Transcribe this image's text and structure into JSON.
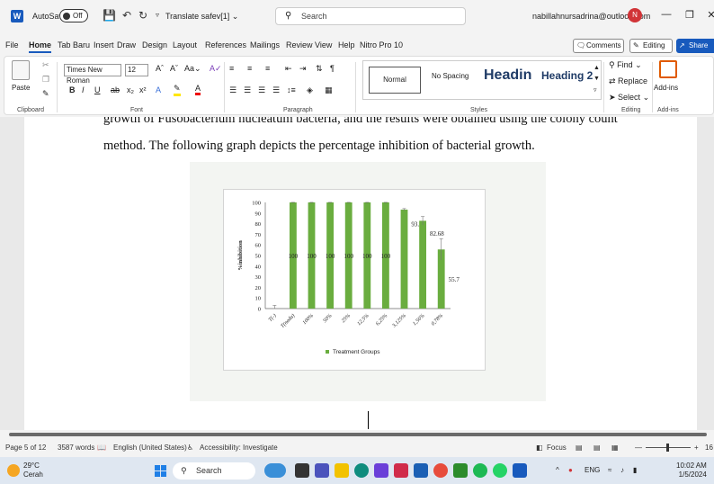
{
  "titlebar": {
    "app_logo": "W",
    "autosave_label": "AutoSave",
    "autosave_state": "Off",
    "doc_title": "Translate safev[1] ⌄",
    "search_placeholder": "Search",
    "account": "nabillahnursadrina@outlook.com",
    "avatar_initial": "N"
  },
  "tabs": [
    "File",
    "Home",
    "Tab Baru",
    "Insert",
    "Draw",
    "Design",
    "Layout",
    "References",
    "Mailings",
    "Review",
    "View",
    "Help",
    "Nitro Pro 10"
  ],
  "active_tab": "Home",
  "header_buttons": {
    "comments": "Comments",
    "editing": "Editing ⌄",
    "share": "Share"
  },
  "ribbon": {
    "paste_label": "Paste",
    "font_name": "Times New Roman",
    "font_size": "12",
    "bold": "B",
    "italic": "I",
    "underline": "U",
    "styles": {
      "normal": "Normal",
      "no_spacing": "No Spacing",
      "heading1": "Headin",
      "heading2": "Heading 2"
    },
    "find": "Find",
    "replace": "Replace",
    "select": "Select",
    "addins": "Add-ins",
    "groups": {
      "clipboard": "Clipboard",
      "font": "Font",
      "paragraph": "Paragraph",
      "styles": "Styles",
      "editing": "Editing",
      "addins": "Add-ins"
    }
  },
  "document": {
    "line1": "growth of Fusobacterium nucleatum bacteria, and the results were obtained using the colony count",
    "line2": "method. The following graph depicts the percentage inhibition of bacterial growth."
  },
  "chart_data": {
    "type": "bar",
    "categories": [
      "T(-)",
      "T(nada)",
      "100%",
      "50%",
      "25%",
      "12,5%",
      "6,25%",
      "3,125%",
      "1,56%",
      "0,78%"
    ],
    "values": [
      0,
      100,
      100,
      100,
      100,
      100,
      100,
      93.2,
      82.68,
      55.7
    ],
    "data_labels": [
      "",
      "100",
      "100",
      "100",
      "100",
      "100",
      "100",
      "93.2",
      "82.68",
      "55.7"
    ],
    "errors": [
      3,
      0,
      0,
      0,
      0,
      0,
      0,
      1,
      4,
      10
    ],
    "ylabel": "%inhibition",
    "ylim": [
      0,
      100
    ],
    "yticks": [
      0,
      10,
      20,
      30,
      40,
      50,
      60,
      70,
      80,
      90,
      100
    ],
    "legend": "Treatment Groups",
    "legend_position": "bottom",
    "bar_color": "#6aad3f",
    "grid": false
  },
  "status": {
    "page": "Page 5 of 12",
    "words": "3587 words",
    "language": "English (United States)",
    "accessibility": "Accessibility: Investigate",
    "focus": "Focus",
    "zoom": "16"
  },
  "taskbar": {
    "temp": "29°C",
    "condition": "Cerah",
    "search": "Search",
    "lang": "ENG",
    "time": "10:02 AM",
    "date": "1/5/2024"
  }
}
